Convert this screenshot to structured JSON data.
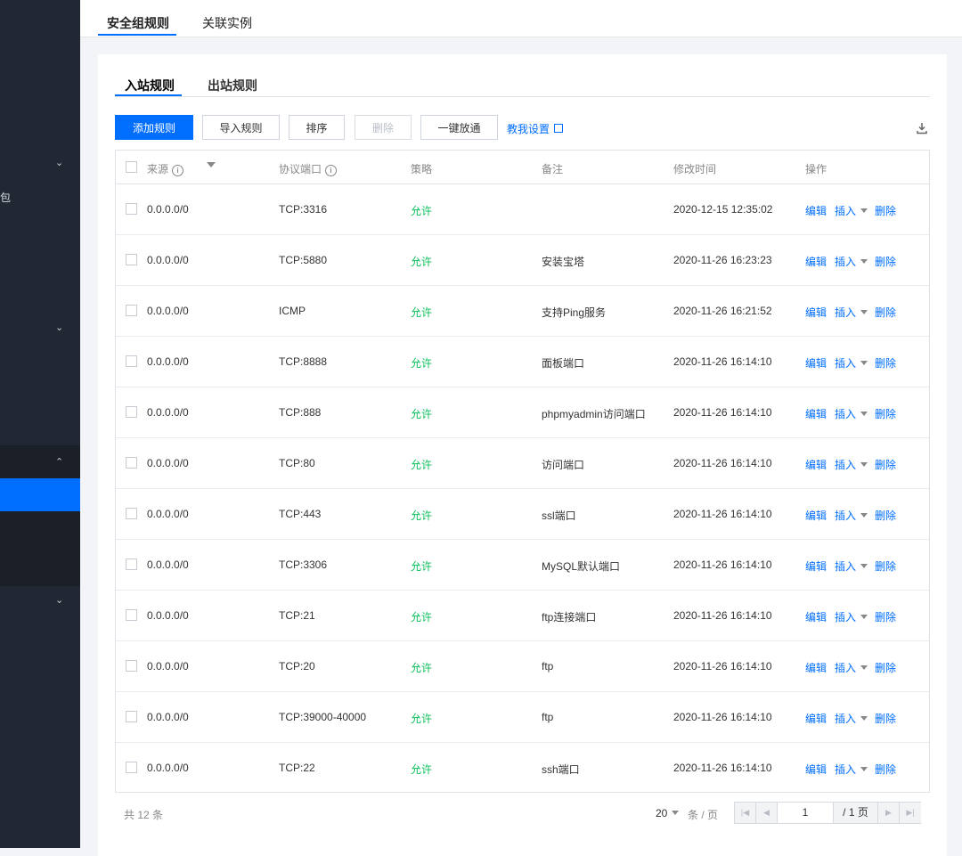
{
  "sidebar": {
    "label_fragment": "包",
    "colors": {
      "bg": "#222833",
      "active": "#006eff",
      "band": "#1a1f28"
    }
  },
  "top_tabs": [
    {
      "label": "安全组规则",
      "active": true
    },
    {
      "label": "关联实例",
      "active": false
    }
  ],
  "sub_tabs": [
    {
      "label": "入站规则",
      "active": true
    },
    {
      "label": "出站规则",
      "active": false
    }
  ],
  "toolbar": {
    "add": "添加规则",
    "import": "导入规则",
    "sort": "排序",
    "delete": "删除",
    "open_all": "一键放通",
    "help": "教我设置",
    "download_icon": "download-icon"
  },
  "table": {
    "headers": {
      "source": "来源",
      "protocol_port": "协议端口",
      "policy": "策略",
      "note": "备注",
      "modified": "修改时间",
      "actions": "操作"
    },
    "action_labels": {
      "edit": "编辑",
      "insert": "插入",
      "delete": "删除"
    },
    "rows": [
      {
        "source": "0.0.0.0/0",
        "port": "TCP:3316",
        "policy": "允许",
        "note": "",
        "time": "2020-12-15 12:35:02"
      },
      {
        "source": "0.0.0.0/0",
        "port": "TCP:5880",
        "policy": "允许",
        "note": "安装宝塔",
        "time": "2020-11-26 16:23:23"
      },
      {
        "source": "0.0.0.0/0",
        "port": "ICMP",
        "policy": "允许",
        "note": "支持Ping服务",
        "time": "2020-11-26 16:21:52"
      },
      {
        "source": "0.0.0.0/0",
        "port": "TCP:8888",
        "policy": "允许",
        "note": "面板端口",
        "time": "2020-11-26 16:14:10"
      },
      {
        "source": "0.0.0.0/0",
        "port": "TCP:888",
        "policy": "允许",
        "note": "phpmyadmin访问端口",
        "time": "2020-11-26 16:14:10"
      },
      {
        "source": "0.0.0.0/0",
        "port": "TCP:80",
        "policy": "允许",
        "note": "访问端口",
        "time": "2020-11-26 16:14:10"
      },
      {
        "source": "0.0.0.0/0",
        "port": "TCP:443",
        "policy": "允许",
        "note": "ssl端口",
        "time": "2020-11-26 16:14:10"
      },
      {
        "source": "0.0.0.0/0",
        "port": "TCP:3306",
        "policy": "允许",
        "note": "MySQL默认端口",
        "time": "2020-11-26 16:14:10"
      },
      {
        "source": "0.0.0.0/0",
        "port": "TCP:21",
        "policy": "允许",
        "note": "ftp连接端口",
        "time": "2020-11-26 16:14:10"
      },
      {
        "source": "0.0.0.0/0",
        "port": "TCP:20",
        "policy": "允许",
        "note": "ftp",
        "time": "2020-11-26 16:14:10"
      },
      {
        "source": "0.0.0.0/0",
        "port": "TCP:39000-40000",
        "policy": "允许",
        "note": "ftp",
        "time": "2020-11-26 16:14:10"
      },
      {
        "source": "0.0.0.0/0",
        "port": "TCP:22",
        "policy": "允许",
        "note": "ssh端口",
        "time": "2020-11-26 16:14:10"
      }
    ]
  },
  "pagination": {
    "total": "共 12 条",
    "page_size": "20",
    "per_page_unit": "条 / 页",
    "current_page": "1",
    "total_pages": "/ 1 页"
  },
  "colors": {
    "primary": "#006eff",
    "allow": "#0abf5b"
  }
}
